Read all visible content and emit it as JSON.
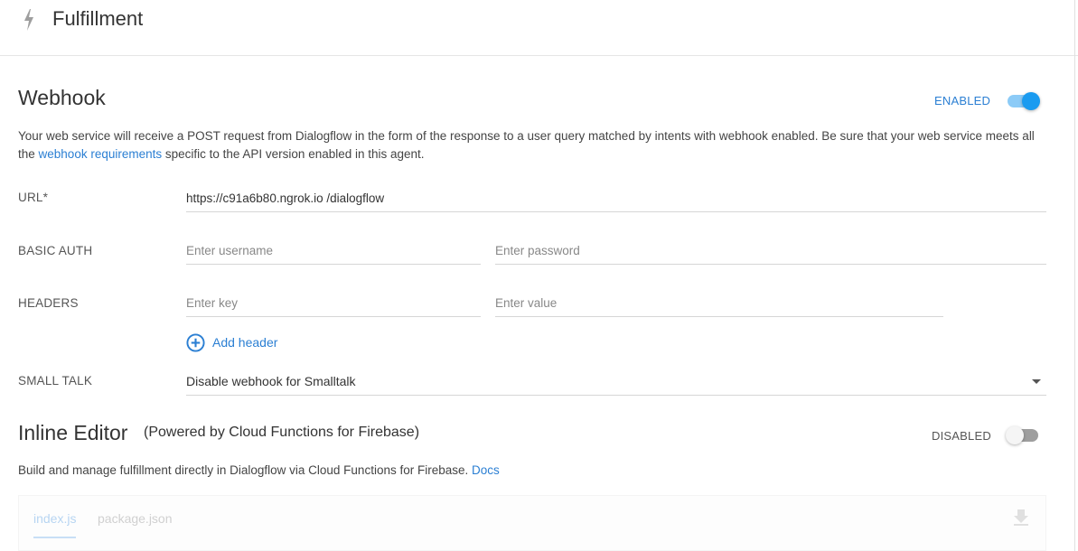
{
  "header": {
    "title": "Fulfillment",
    "icon": "bolt-icon"
  },
  "webhook": {
    "title": "Webhook",
    "status_label": "ENABLED",
    "enabled": true,
    "desc_part1": "Your web service will receive a POST request from Dialogflow in the form of the response to a user query matched by intents with webhook enabled. Be sure that your web service meets all the ",
    "desc_link": "webhook requirements",
    "desc_part2": " specific to the API version enabled in this agent.",
    "url_label": "URL*",
    "url_value": "https://c91a6b80.ngrok.io /dialogflow",
    "basic_auth_label": "BASIC AUTH",
    "username_placeholder": "Enter username",
    "password_placeholder": "Enter password",
    "headers_label": "HEADERS",
    "key_placeholder": "Enter key",
    "value_placeholder": "Enter value",
    "add_header_label": "Add header",
    "small_talk_label": "SMALL TALK",
    "small_talk_selected": "Disable webhook for Smalltalk"
  },
  "inline_editor": {
    "title": "Inline Editor",
    "subtitle": "(Powered by Cloud Functions for Firebase)",
    "status_label": "DISABLED",
    "enabled": false,
    "desc": "Build and manage fulfillment directly in Dialogflow via Cloud Functions for Firebase. ",
    "docs_link": "Docs",
    "tabs": [
      "index.js",
      "package.json"
    ]
  },
  "colors": {
    "accent": "#2b7fd3",
    "toggle_on_knob": "#1a9bf0",
    "toggle_on_track": "#8ccbf7",
    "toggle_off_knob": "#f5f5f5",
    "toggle_off_track": "#9e9e9e"
  }
}
